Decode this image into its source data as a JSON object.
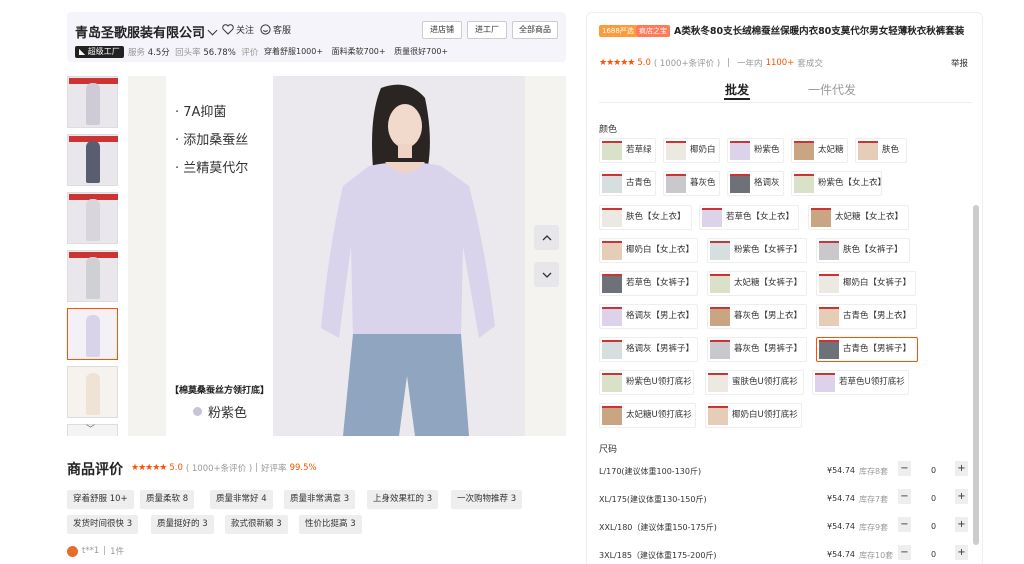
{
  "shop": {
    "name": "青岛圣歌服装有限公司",
    "follow_label": "关注",
    "service_label": "客服",
    "buttons": [
      "进店铺",
      "进工厂",
      "全部商品"
    ],
    "badge": "超级工厂",
    "stats": {
      "service_label": "服务",
      "service_value": "4.5分",
      "repurchase_label": "回头率",
      "repurchase_value": "56.78%",
      "review_label": "评价"
    },
    "tags": [
      "穿着舒服1000+",
      "面料柔软700+",
      "质量很好700+"
    ]
  },
  "gallery": {
    "features": [
      "· 7A抑菌",
      "· 添加桑蚕丝",
      "· 兰精莫代尔"
    ],
    "caption": "【棉莫桑蚕丝方领打底】",
    "color_name": "粉紫色",
    "arrow_up": "^",
    "arrow_down": "v"
  },
  "reviews": {
    "title": "商品评价",
    "stars": "★★★★★",
    "score": "5.0",
    "count": "( 1000+条评价 )",
    "sep": "|",
    "good_label": "好评率",
    "good_rate": "99.5%",
    "tags": [
      "穿着舒服 10+",
      "质量柔软 8",
      "质量非常好 4",
      "质量非常满意 3",
      "上身效果杠的 3",
      "一次购物推荐 3",
      "发货时间很快 3",
      "质量挺好的 3",
      "款式很新颖 3",
      "性价比挺高 3"
    ],
    "reviewer": "t**1",
    "reviewer_count": "1件"
  },
  "product": {
    "tag1": "1688严选",
    "tag2": "疯店之宝",
    "title": "A类秋冬80支长绒棉蚕丝保暖内衣80支莫代尔男女轻薄秋衣秋裤套装",
    "stars": "★★★★★",
    "rating": "5.0",
    "rating_count": "( 1000+条评价 )",
    "sales_pre": "一年内",
    "sales_num": "1100+",
    "sales_post": "套成交",
    "report": "举报",
    "tabs": [
      "批发",
      "一件代发"
    ]
  },
  "colors": {
    "label": "颜色",
    "items": [
      "若草绿",
      "椰奶白",
      "粉紫色",
      "太妃糖",
      "肤色",
      "古青色",
      "暮灰色",
      "格调灰",
      "粉紫色【女上衣】",
      "肤色【女上衣】",
      "若草色【女上衣】",
      "太妃糖【女上衣】",
      "椰奶白【女上衣】",
      "粉紫色【女裤子】",
      "肤色【女裤子】",
      "若草色【女裤子】",
      "太妃糖【女裤子】",
      "椰奶白【女裤子】",
      "格调灰【男上衣】",
      "暮灰色【男上衣】",
      "古青色【男上衣】",
      "格调灰【男裤子】",
      "暮灰色【男裤子】",
      "古青色【男裤子】",
      "粉紫色U领打底衫",
      "蜜肤色U领打底衫",
      "若草色U领打底衫",
      "太妃糖U领打底衫",
      "椰奶白U领打底衫"
    ],
    "selected": "古青色【男裤子】"
  },
  "sizes": {
    "label": "尺码",
    "rows": [
      {
        "name": "L/170(建议体重100-130斤)",
        "price": "¥54.74",
        "stock": "库存8套",
        "qty": "0"
      },
      {
        "name": "XL/175(建议体重130-150斤)",
        "price": "¥54.74",
        "stock": "库存7套",
        "qty": "0"
      },
      {
        "name": "XXL/180（建议体重150-175斤)",
        "price": "¥54.74",
        "stock": "库存9套",
        "qty": "0"
      },
      {
        "name": "3XL/185（建议体重175-200斤)",
        "price": "¥54.74",
        "stock": "库存10套",
        "qty": "0"
      }
    ],
    "minus": "−",
    "plus": "+"
  },
  "palette": {
    "accent": "#ff5000",
    "tag1_bg": "#ff9a3c",
    "tag2_bg": "#ff7a59"
  }
}
